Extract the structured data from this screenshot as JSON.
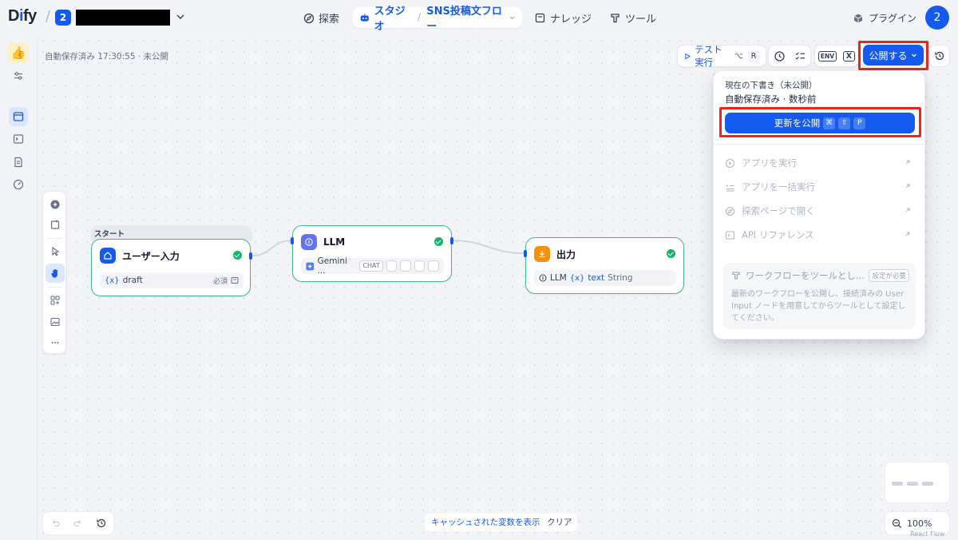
{
  "header": {
    "logo_pre": "D",
    "logo_i": "i",
    "logo_post": "fy",
    "workspace_badge": "2",
    "nav": {
      "explore": "探索",
      "studio": "スタジオ",
      "app_name": "SNS投稿文フロー",
      "knowledge": "ナレッジ",
      "tools": "ツール"
    },
    "plugins": "プラグイン",
    "avatar": "2"
  },
  "app": {
    "icon": "👍"
  },
  "canvas": {
    "autosave_status": "自動保存済み 17:30:55 · 未公開"
  },
  "toolbar": {
    "test_run": "テスト実行",
    "test_run_kbd1": "⌥",
    "test_run_kbd2": "R",
    "env_label": "ENV",
    "var_label": "X",
    "publish": "公開する"
  },
  "publish_menu": {
    "status": "現在の下書き（未公開）",
    "saved": "自動保存済み · 数秒前",
    "update_button": "更新を公開",
    "kbd": [
      "⌘",
      "⇧",
      "P"
    ],
    "items": [
      "アプリを実行",
      "アプリを一括実行",
      "探索ページで開く",
      "API リファレンス"
    ],
    "tool_card": {
      "title": "ワークフローをツールとし...",
      "badge": "設定が必要",
      "description": "最新のワークフローを公開し、接続済みの User Input ノードを用意してからツールとして設定してください。"
    }
  },
  "nodes": {
    "start_label": "スタート",
    "user_input": {
      "title": "ユーザー入力",
      "var_prefix": "{x}",
      "var_name": "draft",
      "required": "必須"
    },
    "llm": {
      "title": "LLM",
      "model": "Gemini ...",
      "mode": "CHAT"
    },
    "output": {
      "title": "出力",
      "source": "LLM",
      "var_prefix": "{x}",
      "var_name": "text",
      "type": "String"
    }
  },
  "bottom": {
    "cache_vars": "キャッシュされた変数を表示",
    "clear": "クリア",
    "zoom": "100%",
    "attribution": "React Flow"
  },
  "colors": {
    "primary": "#155aef",
    "success": "#17b26a",
    "node_border": "#3fb98b",
    "highlight": "#e8261a"
  }
}
